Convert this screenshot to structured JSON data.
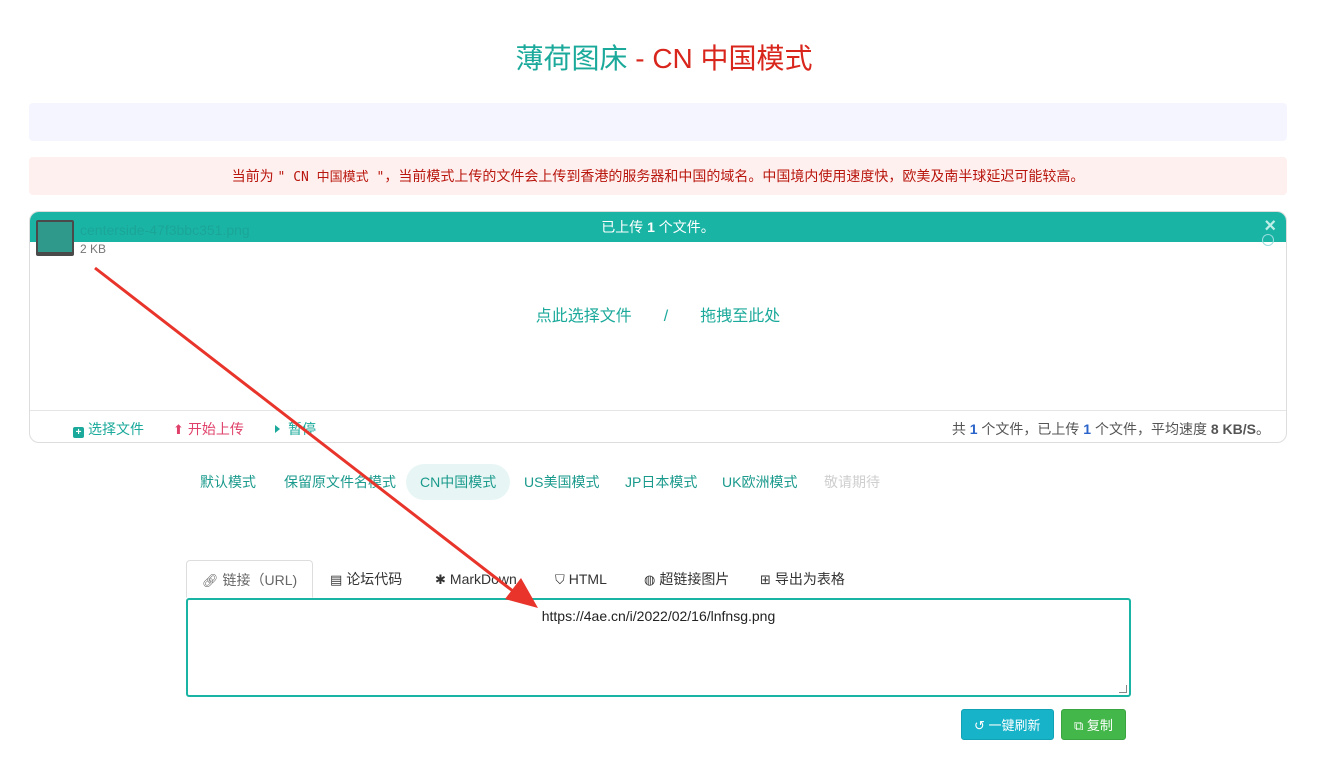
{
  "header": {
    "title_part1": "薄荷图床",
    "title_part2": " - CN 中国模式"
  },
  "notice": {
    "prefix": "当前为 ",
    "mode_quote": "\" CN 中国模式 \"",
    "suffix": "，当前模式上传的文件会上传到香港的服务器和中国的域名。中国境内使用速度快，欧美及南半球延迟可能较高。"
  },
  "uploader": {
    "status_prefix": "已上传 ",
    "status_count": "1",
    "status_suffix": " 个文件。",
    "close_glyph": "×",
    "file": {
      "name": "centerside-47f3bbc351.png",
      "size": "2 KB"
    },
    "drop_select": "点此选择文件",
    "drop_sep": "/",
    "drop_drag": "拖拽至此处",
    "footer": {
      "select_label": "选择文件",
      "start_label": "开始上传",
      "pause_label": "暂停",
      "stat_prefix": "共 ",
      "stat_total": "1",
      "stat_mid": " 个文件，已上传 ",
      "stat_uploaded": "1",
      "stat_mid2": " 个文件，平均速度 ",
      "stat_speed": "8 KB/S",
      "stat_end": "。"
    }
  },
  "modes": [
    {
      "label": "默认模式"
    },
    {
      "label": "保留原文件名模式"
    },
    {
      "label": "CN中国模式",
      "active": true
    },
    {
      "label": "US美国模式"
    },
    {
      "label": "JP日本模式"
    },
    {
      "label": "UK欧洲模式"
    },
    {
      "label": "敬请期待",
      "disabled": true
    }
  ],
  "tabs": [
    {
      "label": "链接（URL)",
      "icon": "link-icon"
    },
    {
      "label": "论坛代码",
      "icon": "comment-icon"
    },
    {
      "label": "MarkDown",
      "icon": "asterisk-icon"
    },
    {
      "label": "HTML",
      "icon": "html5-icon"
    },
    {
      "label": "超链接图片",
      "icon": "globe-icon"
    },
    {
      "label": "导出为表格",
      "icon": "table-icon"
    }
  ],
  "output": {
    "value": "https://4ae.cn/i/2022/02/16/lnfnsg.png"
  },
  "buttons": {
    "refresh_label": "一键刷新",
    "copy_label": "复制"
  },
  "colors": {
    "accent": "#1ab4a5",
    "danger": "#d9261c",
    "refresh": "#17b3c9",
    "copy": "#43b749",
    "annotation_arrow": "#e8342a"
  }
}
